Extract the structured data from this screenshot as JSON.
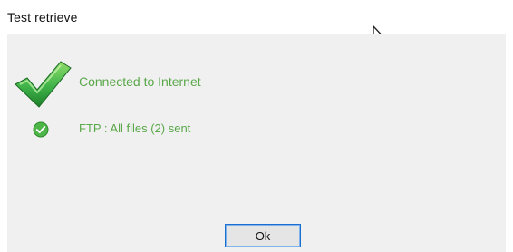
{
  "dialog": {
    "title": "Test retrieve",
    "status_main": "Connected to Internet",
    "status_ftp": "FTP : All files (2) sent",
    "ok_label": "Ok"
  },
  "icons": {
    "big": "check-icon",
    "small": "success-check-circle-icon",
    "pointer": "mouse-cursor-icon"
  },
  "colors": {
    "success": "#5aa84a",
    "button_border": "#1a6fd1",
    "panel_bg": "#f0f0f0"
  }
}
